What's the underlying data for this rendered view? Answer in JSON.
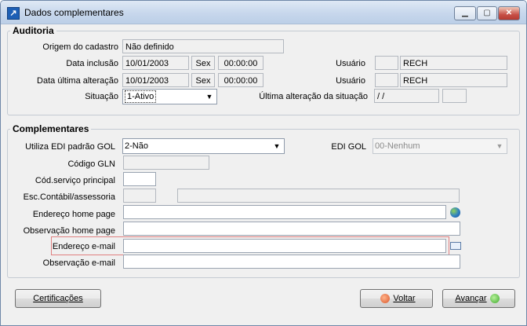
{
  "window": {
    "title": "Dados complementares"
  },
  "auditoria": {
    "title": "Auditoria",
    "origem_label": "Origem do cadastro",
    "origem_value": "Não definido",
    "inclusao_label": "Data inclusão",
    "inclusao_date": "10/01/2003",
    "inclusao_day": "Sex",
    "inclusao_time": "00:00:00",
    "alteracao_label": "Data última alteração",
    "alteracao_date": "10/01/2003",
    "alteracao_day": "Sex",
    "alteracao_time": "00:00:00",
    "usuario_label": "Usuário",
    "usuario1_code": "",
    "usuario1_name": "RECH",
    "usuario2_code": "",
    "usuario2_name": "RECH",
    "situacao_label": "Situação",
    "situacao_value": "1-Ativo",
    "ultima_alt_label": "Última alteração da situação",
    "ultima_alt_date": " / /",
    "ultima_alt_extra": ""
  },
  "complementares": {
    "title": "Complementares",
    "edi_label": "Utiliza EDI padrão GOL",
    "edi_value": "2-Não",
    "edi_gol_label": "EDI GOL",
    "edi_gol_value": "00-Nenhum",
    "gln_label": "Código GLN",
    "gln_value": "",
    "cod_servico_label": "Cód.serviço principal",
    "cod_servico_value": "",
    "esc_contabil_label": "Esc.Contábil/assessoria",
    "esc_code": "",
    "esc_name": "",
    "homepage_label": "Endereço home page",
    "homepage_value": "",
    "obs_homepage_label": "Observação home page",
    "obs_homepage_value": "",
    "email_label": "Endereço e-mail",
    "email_value": "",
    "obs_email_label": "Observação e-mail",
    "obs_email_value": ""
  },
  "buttons": {
    "certificacoes": "Certificações",
    "voltar": "Voltar",
    "avancar": "Avançar"
  },
  "icons": {
    "app": "app-arrow-icon",
    "homepage": "globe-icon",
    "email": "envelope-icon",
    "voltar": "back-arrow-icon",
    "avancar": "forward-arrow-icon"
  },
  "colors": {
    "highlight_border": "#e08080",
    "titlebar": "#c7d7ec"
  }
}
